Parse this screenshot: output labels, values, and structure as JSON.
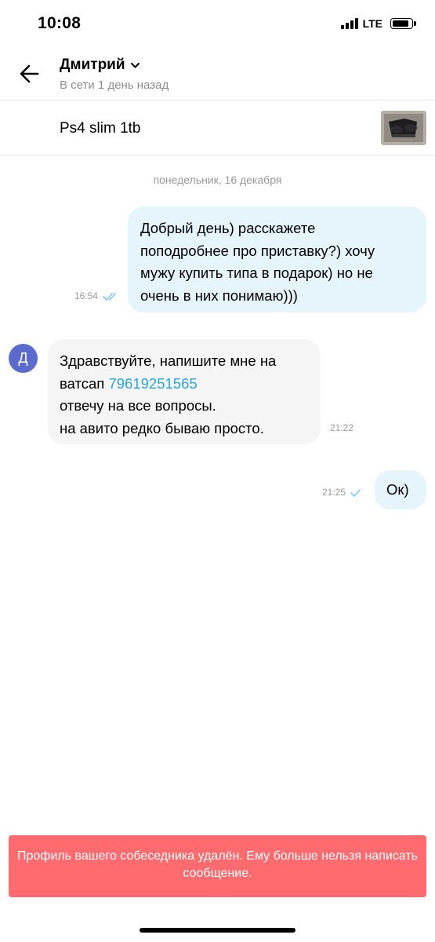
{
  "status_bar": {
    "time": "10:08",
    "network": "LTE"
  },
  "header": {
    "name": "Дмитрий",
    "status": "В сети 1 день назад",
    "back_icon": "arrow-left-icon",
    "dropdown_icon": "chevron-down-icon"
  },
  "item": {
    "title": "Ps4 slim 1tb"
  },
  "chat": {
    "date": "понедельник, 16 декабря",
    "messages": [
      {
        "lines": [
          "Добрый день) расскажете",
          "поподробнее про приставку?) хочу",
          "мужу купить типа в подарок) но не",
          "очень в них понимаю)))"
        ],
        "time": "16:54",
        "status": "read"
      },
      {
        "avatar": "Д",
        "line1": "Здравствуйте,  напишите мне на",
        "line2_prefix": "ватсап ",
        "phone": "79619251565",
        "line3": "отвечу на все вопросы.",
        "line4": "на авито редко бываю просто.",
        "time": "21:22"
      },
      {
        "text": "Ок)",
        "time": "21:25",
        "status": "sent"
      }
    ]
  },
  "banner": {
    "text": "Профиль вашего собеседника удалён. Ему больше нельзя написать сообщение."
  },
  "colors": {
    "outgoing_bubble": "#e6f5fc",
    "incoming_bubble": "#f5f5f5",
    "link": "#2aa3dd",
    "banner": "#ff6b6e",
    "avatar": "#5b6acd",
    "check": "#7fc8ec"
  }
}
